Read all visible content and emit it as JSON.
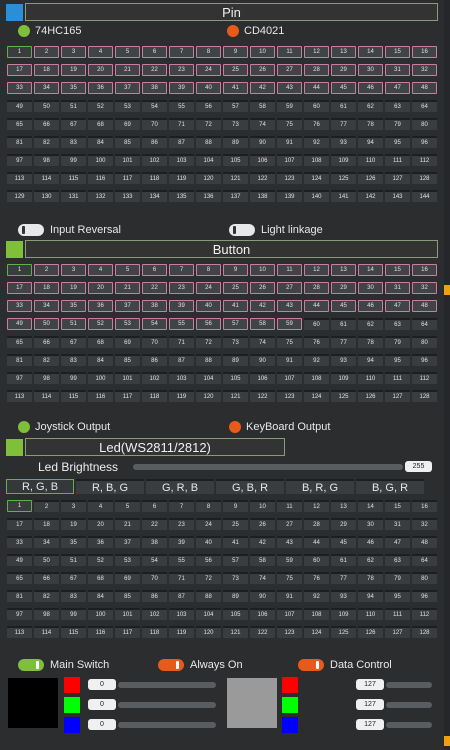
{
  "pin": {
    "title": "Pin",
    "options": [
      {
        "label": "74HC165",
        "color": "#7fbf3a"
      },
      {
        "label": "CD4021",
        "color": "#e85a1a"
      }
    ],
    "grid_start": 1,
    "grid_end": 144,
    "selected_upto": 48,
    "toggles": [
      {
        "label": "Input Reversal"
      },
      {
        "label": "Light linkage"
      }
    ]
  },
  "button": {
    "title": "Button",
    "grid_start": 1,
    "grid_end": 128,
    "selected_upto": 59,
    "options": [
      {
        "label": "Joystick Output",
        "color": "#7fbf3a"
      },
      {
        "label": "KeyBoard Output",
        "color": "#e85a1a"
      }
    ]
  },
  "led": {
    "title": "Led(WS2811/2812)",
    "brightness_label": "Led Brightness",
    "brightness_value": "255",
    "brightness_level": 1.0,
    "orders": [
      "R, G, B",
      "R, B, G",
      "G, R, B",
      "G, B, R",
      "B, R, G",
      "B, G, R"
    ],
    "active_order": "R, G, B",
    "grid_start": 1,
    "grid_end": 128,
    "toggles": [
      {
        "label": "Main Switch",
        "color": "#7fbf3a"
      },
      {
        "label": "Always On",
        "color": "#e85a1a"
      },
      {
        "label": "Data Control",
        "color": "#e85a1a"
      }
    ],
    "left_preview_color": "#000000",
    "right_preview_color": "#9a9a9a",
    "left_channels": [
      {
        "color": "#ff0000",
        "value": "0"
      },
      {
        "color": "#00ff00",
        "value": "0"
      },
      {
        "color": "#0000ff",
        "value": "0"
      }
    ],
    "right_channels": [
      {
        "color": "#ff0000",
        "value": "127"
      },
      {
        "color": "#00ff00",
        "value": "127"
      },
      {
        "color": "#0000ff",
        "value": "127"
      }
    ]
  },
  "colors": {
    "accent_green": "#7fbf3a",
    "accent_orange": "#e85a1a",
    "header_blue": "#2a8fd6"
  }
}
